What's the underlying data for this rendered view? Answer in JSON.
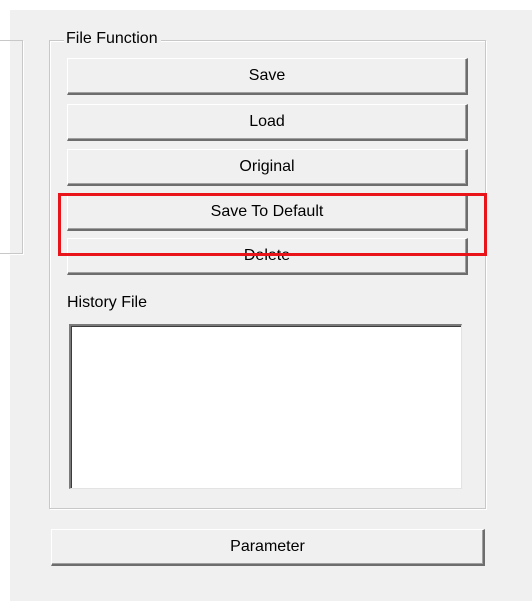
{
  "group": {
    "title": "File Function"
  },
  "buttons": {
    "save": "Save",
    "load": "Load",
    "original": "Original",
    "save_to_default": "Save To Default",
    "delete": "Delete"
  },
  "history": {
    "label": "History File",
    "items": []
  },
  "parameter_button": "Parameter",
  "highlight_color": "#e8141a"
}
